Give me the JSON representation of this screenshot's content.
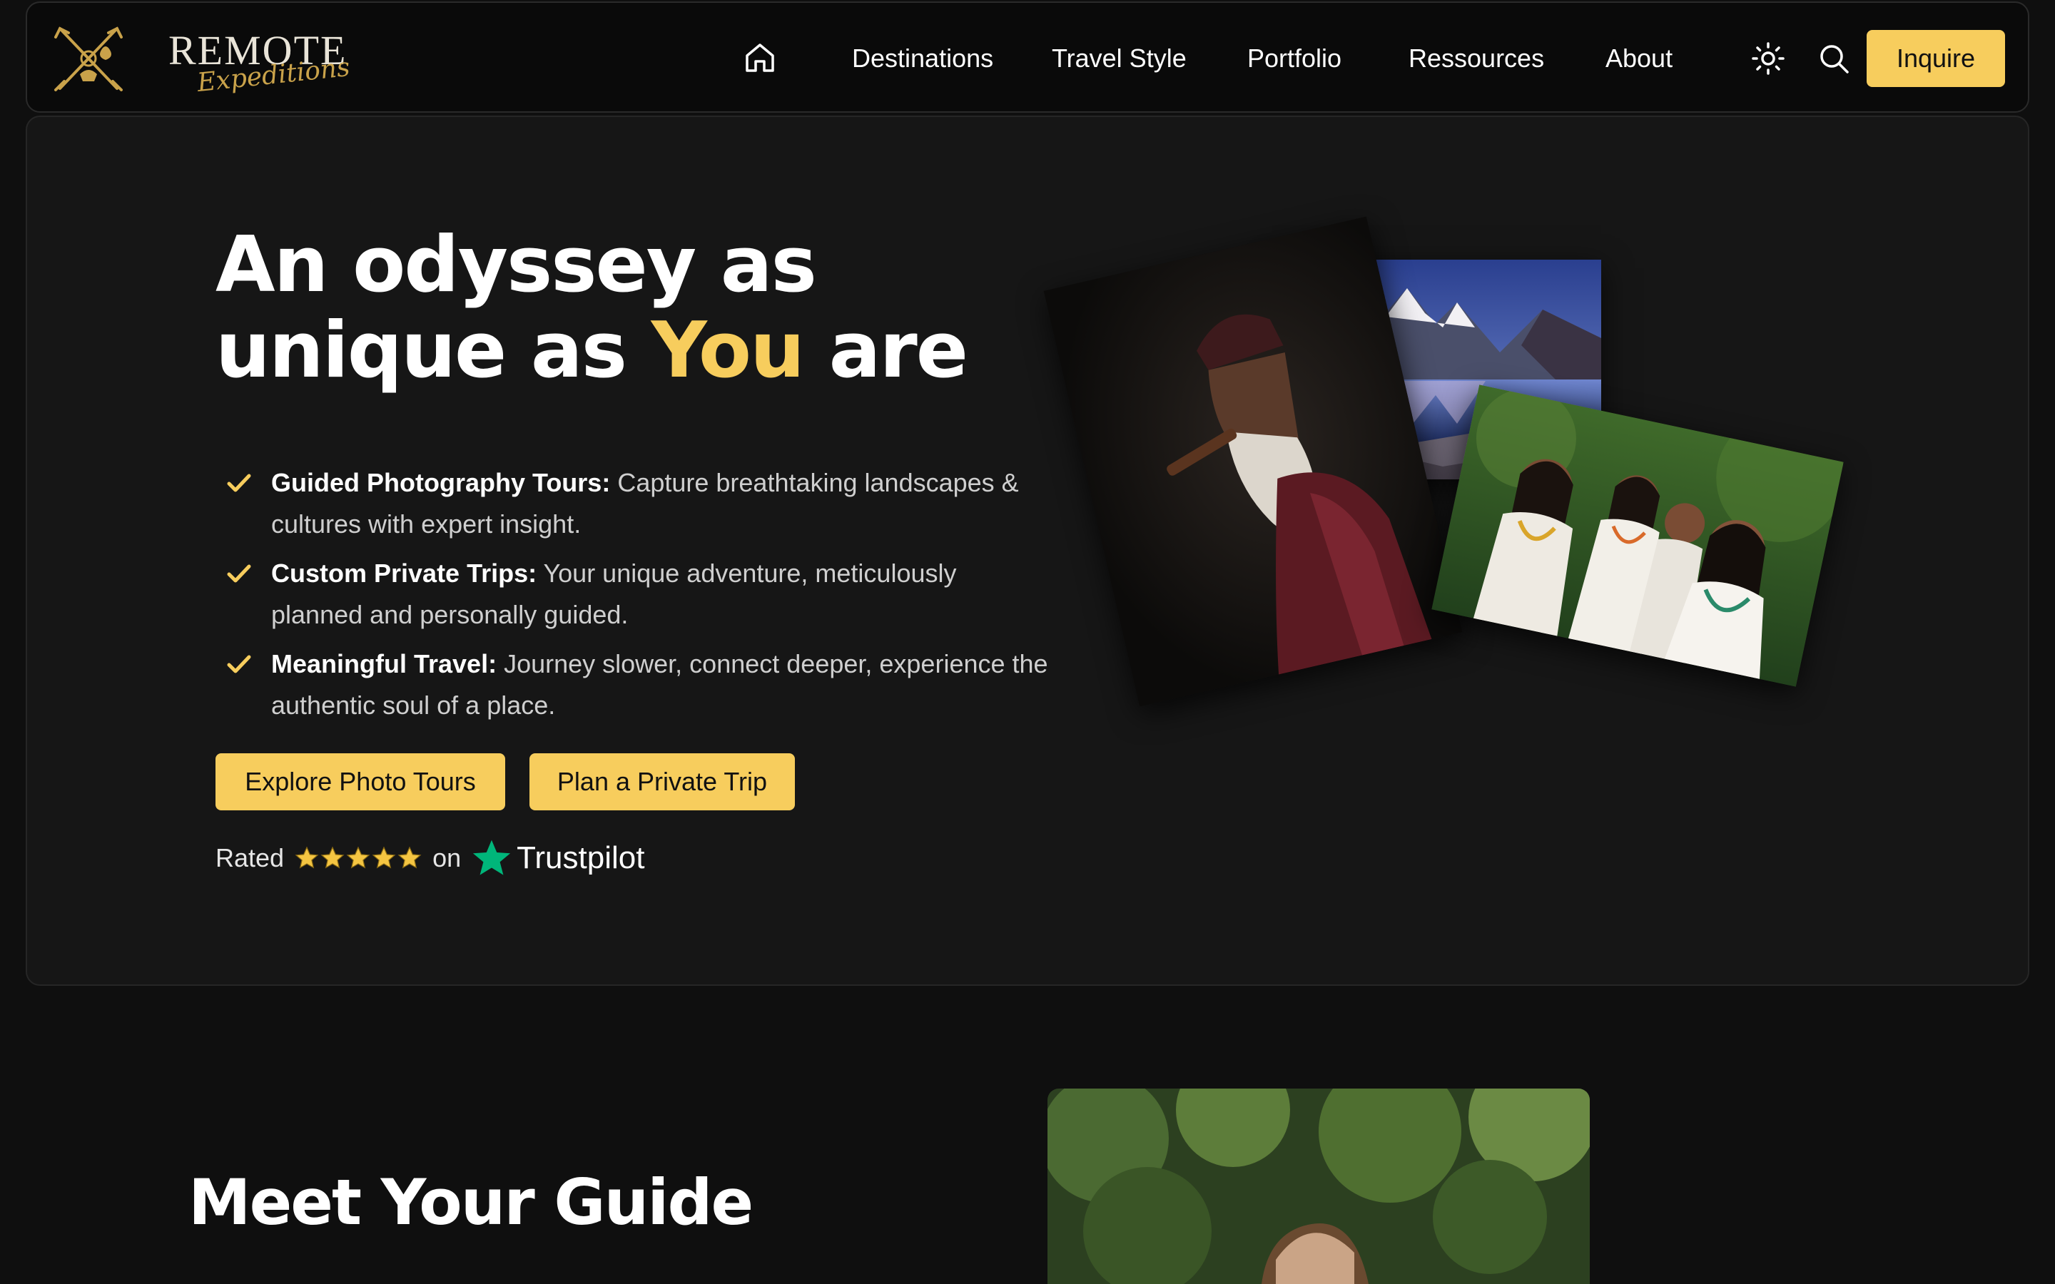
{
  "nav": {
    "logo_word": "REMOTE",
    "logo_script": "Expeditions",
    "items": [
      {
        "label": "Destinations"
      },
      {
        "label": "Travel Style"
      },
      {
        "label": "Portfolio"
      },
      {
        "label": "Ressources"
      },
      {
        "label": "About"
      }
    ],
    "inquire_label": "Inquire",
    "icons": {
      "home": "home-icon",
      "theme": "sun-icon",
      "search": "search-icon"
    }
  },
  "hero": {
    "title_line1": "An odyssey as",
    "title_line2_pre": "unique as ",
    "title_accent": "You",
    "title_line2_post": " are",
    "features": [
      {
        "title": "Guided Photography Tours:",
        "text": " Capture breathtaking landscapes & cultures with expert insight."
      },
      {
        "title": "Custom Private Trips:",
        "text": " Your unique adventure, meticulously planned and personally guided."
      },
      {
        "title": "Meaningful Travel:",
        "text": " Journey slower, connect deeper, experience the authentic soul of a place."
      }
    ],
    "cta_primary": "Explore Photo Tours",
    "cta_secondary": "Plan a Private Trip",
    "rating": {
      "prefix": "Rated",
      "stars": 5,
      "connector": "on",
      "brand": "Trustpilot"
    }
  },
  "guide": {
    "title": "Meet Your Guide"
  },
  "colors": {
    "accent": "#f7cd5d",
    "background": "#0f0f0f",
    "card": "#161616",
    "trustpilot": "#00b67a"
  }
}
